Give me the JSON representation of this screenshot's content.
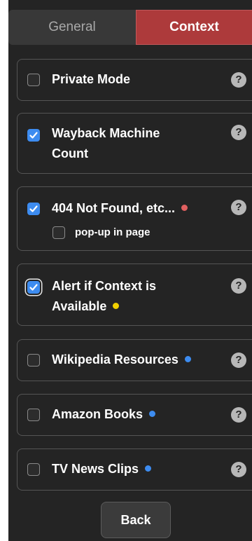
{
  "tabs": [
    {
      "label": "General",
      "active": false
    },
    {
      "label": "Context",
      "active": true
    }
  ],
  "help_glyph": "?",
  "options": [
    {
      "label_lines": [
        "Private Mode"
      ],
      "checked": false,
      "focused": false,
      "dot_color": null
    },
    {
      "label_lines": [
        "Wayback Machine",
        "Count"
      ],
      "checked": true,
      "focused": false,
      "dot_color": null
    },
    {
      "label_lines": [
        "404 Not Found, etc..."
      ],
      "checked": true,
      "focused": false,
      "dot_color": "#e06060",
      "sub_option": {
        "label": "pop-up in page",
        "checked": false
      }
    },
    {
      "label_lines": [
        "Alert if Context is",
        "Available"
      ],
      "checked": true,
      "focused": true,
      "dot_color": "#f0d000"
    },
    {
      "label_lines": [
        "Wikipedia Resources"
      ],
      "checked": false,
      "focused": false,
      "dot_color": "#3d8cf0"
    },
    {
      "label_lines": [
        "Amazon Books"
      ],
      "checked": false,
      "focused": false,
      "dot_color": "#3d8cf0"
    },
    {
      "label_lines": [
        "TV News Clips"
      ],
      "checked": false,
      "focused": false,
      "dot_color": "#3d8cf0"
    }
  ],
  "back_button": {
    "label": "Back"
  },
  "colors": {
    "panel_bg": "#242424",
    "active_tab": "#ad3a3b",
    "checkbox_checked": "#3d8cf0",
    "help_icon": "#b7b7b7"
  }
}
